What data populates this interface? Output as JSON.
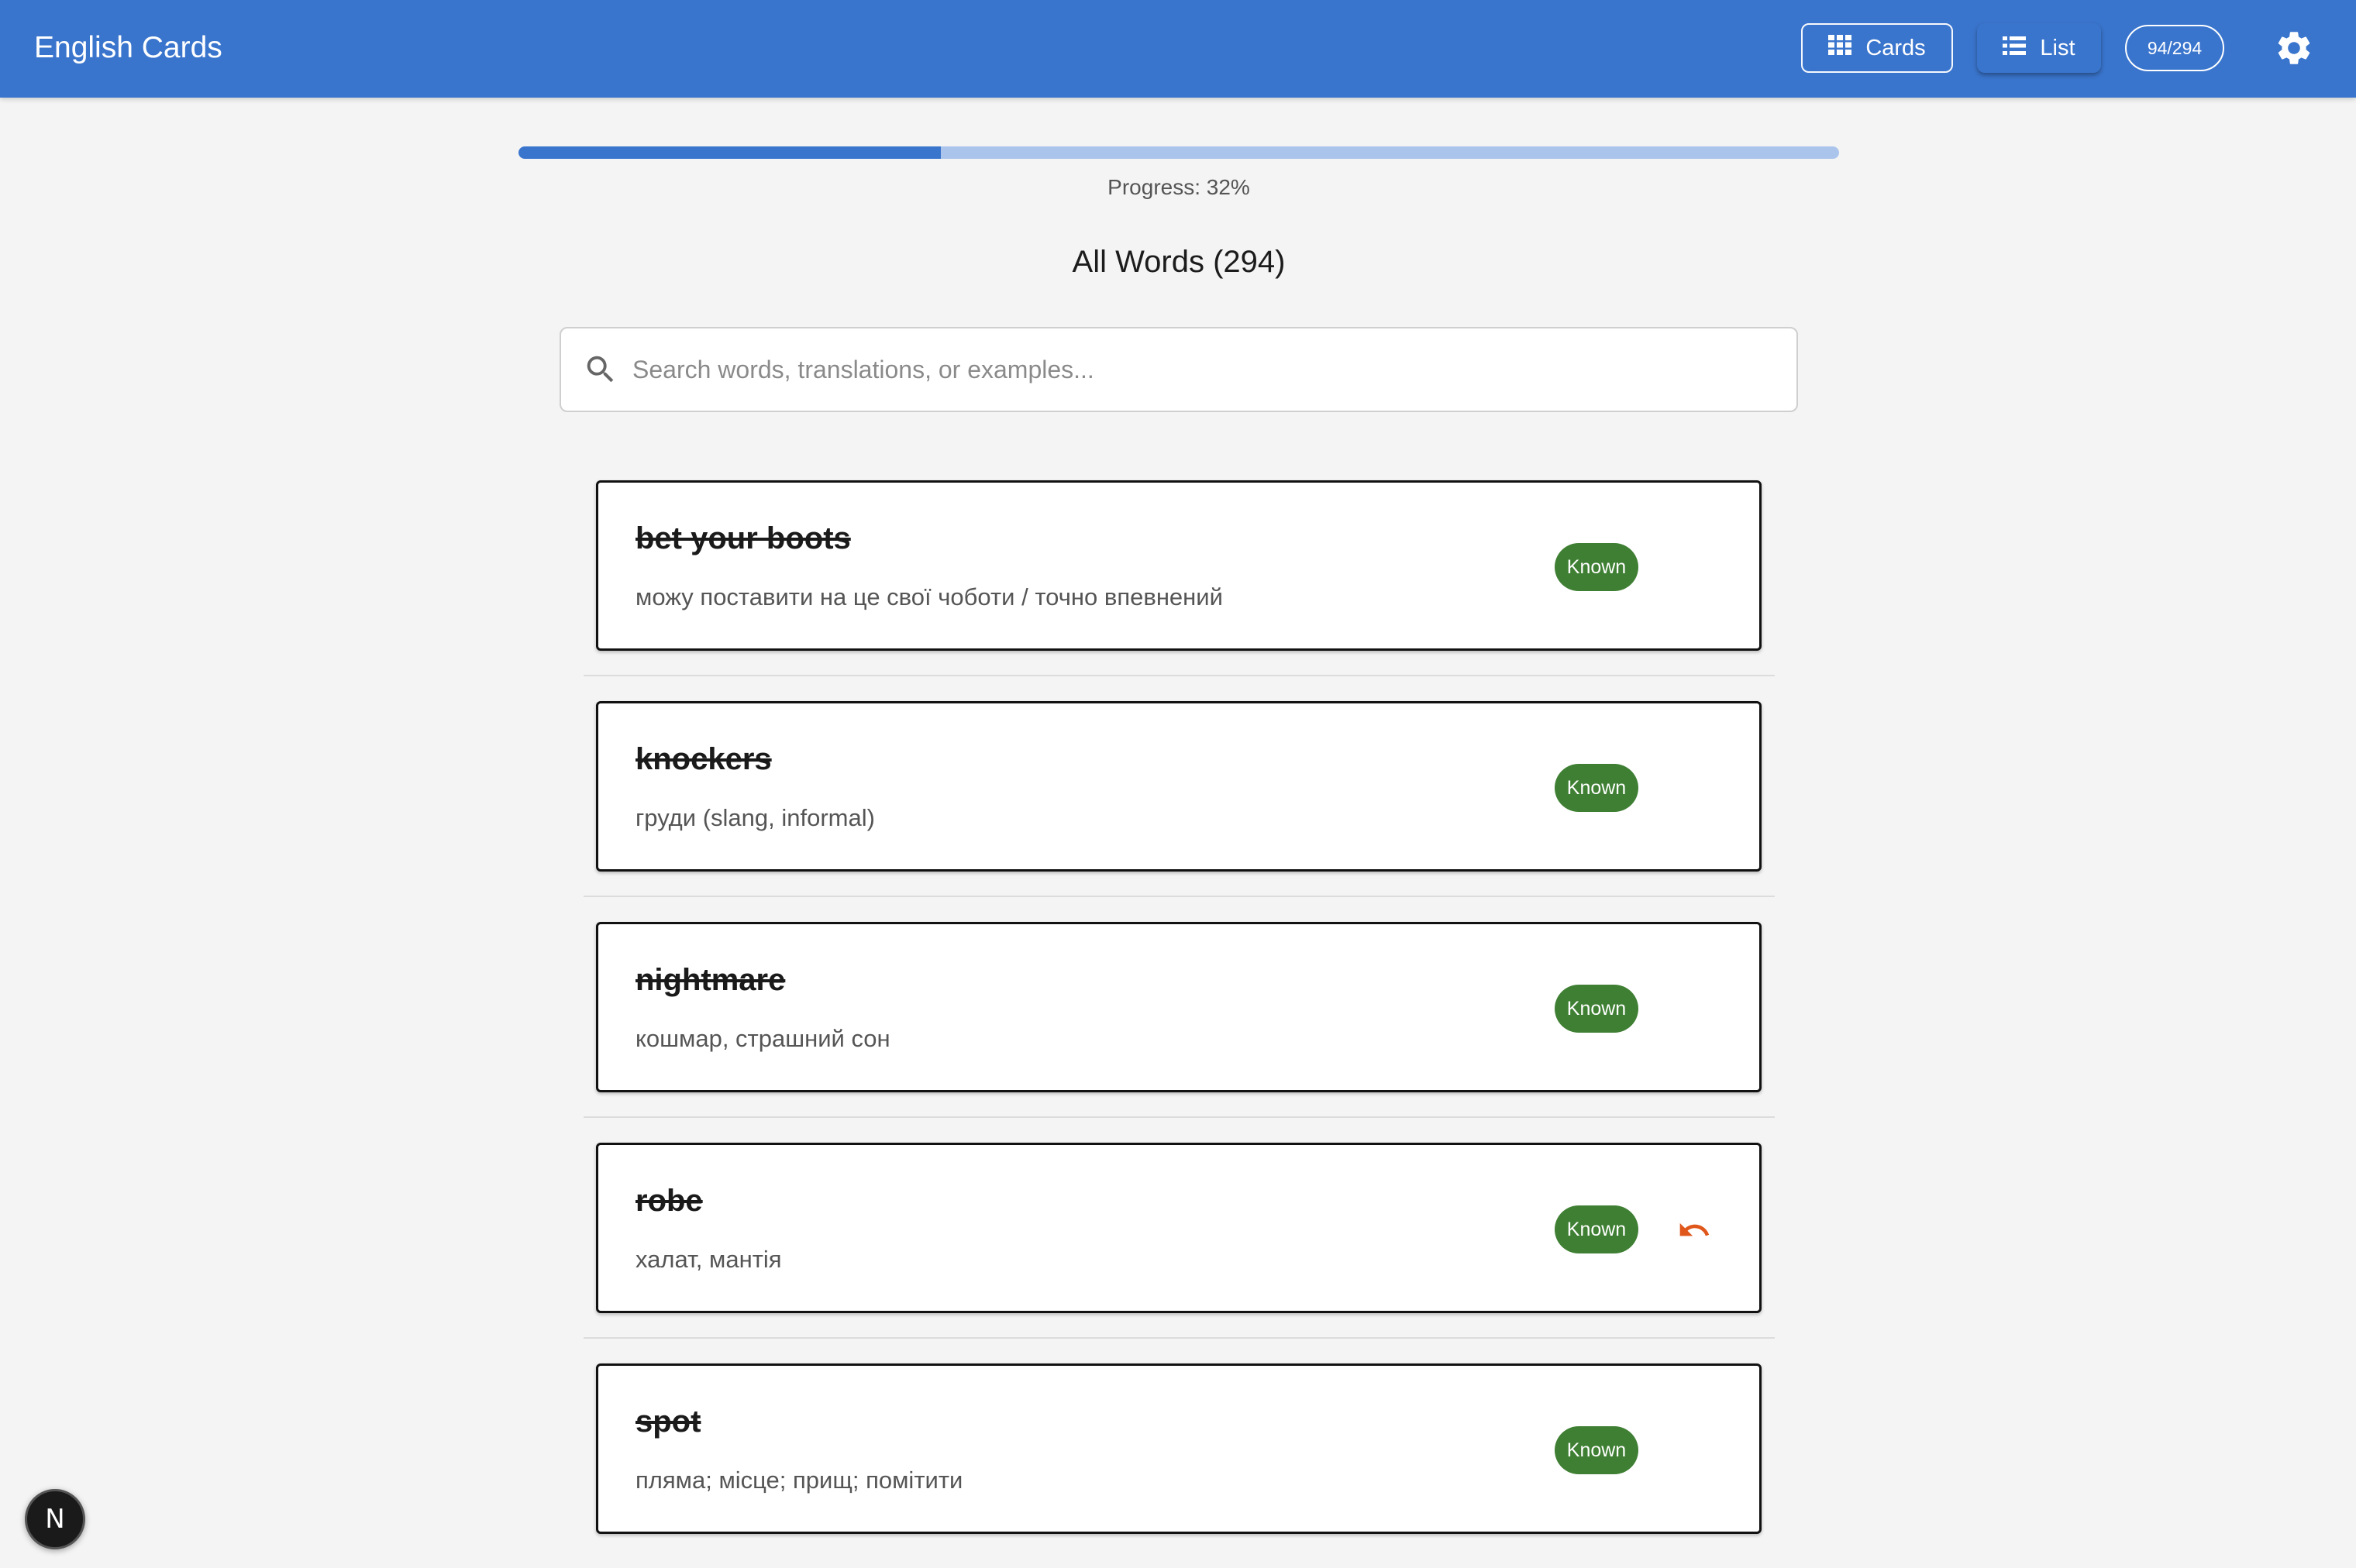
{
  "header": {
    "title": "English Cards",
    "cards_label": "Cards",
    "list_label": "List",
    "counter": "94/294",
    "cards_icon": "grid-icon",
    "list_icon": "list-icon",
    "settings_icon": "gear-icon"
  },
  "progress": {
    "value": 0.32,
    "label": "Progress: 32%"
  },
  "list_title": "All Words (294)",
  "search": {
    "placeholder": "Search words, translations, or examples...",
    "value": "",
    "icon": "search-icon"
  },
  "words": [
    {
      "term": "bet your boots",
      "translation": "можу поставити на це свої чоботи / точно впевнений",
      "status": "Known",
      "undo": false
    },
    {
      "term": "knockers",
      "translation": "груди (slang, informal)",
      "status": "Known",
      "undo": false
    },
    {
      "term": "nightmare",
      "translation": "кошмар, страшний сон",
      "status": "Known",
      "undo": false
    },
    {
      "term": "robe",
      "translation": "халат, мантія",
      "status": "Known",
      "undo": true
    },
    {
      "term": "spot",
      "translation": "пляма; місце; прищ; помітити",
      "status": "Known",
      "undo": false
    }
  ],
  "dev_badge": "N",
  "colors": {
    "primary": "#3a75cd",
    "progress_track": "#aac4ec",
    "known_badge": "#3f7f33",
    "undo": "#e0571b",
    "background": "#f4f4f4"
  }
}
